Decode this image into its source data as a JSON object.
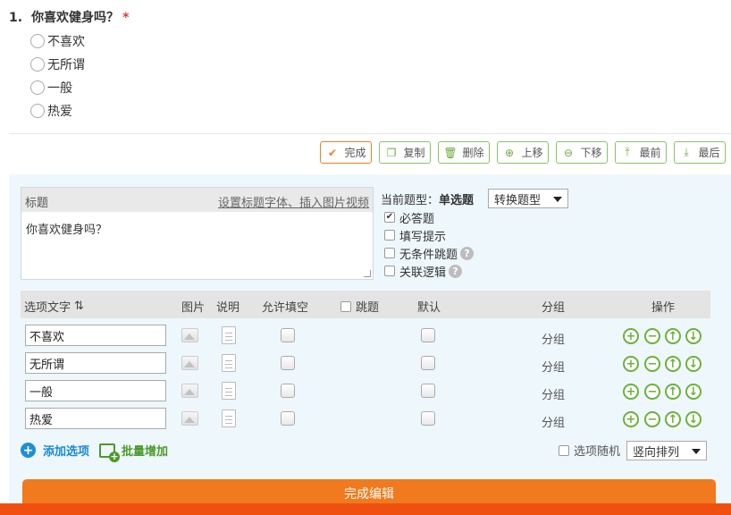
{
  "question": {
    "number": "1.",
    "title": "你喜欢健身吗？",
    "required_mark": "*",
    "options": [
      "不喜欢",
      "无所谓",
      "一般",
      "热爱"
    ]
  },
  "toolbar": {
    "done": "完成",
    "copy": "复制",
    "delete": "删除",
    "move_up": "上移",
    "move_down": "下移",
    "top": "最前",
    "bottom": "最后"
  },
  "editor": {
    "title_label": "标题",
    "title_link": "设置标题字体、插入图片视频",
    "title_value": "你喜欢健身吗？",
    "current_type_label": "当前题型：",
    "current_type": "单选题",
    "switch_type": "转换题型",
    "required_label": "必答题",
    "required_checked": true,
    "hint_label": "填写提示",
    "jump_label": "无条件跳题",
    "logic_label": "关联逻辑"
  },
  "table": {
    "headers": {
      "option_text": "选项文字",
      "image": "图片",
      "desc": "说明",
      "fill": "允许填空",
      "jump": "跳题",
      "default": "默认",
      "group": "分组",
      "ops": "操作"
    },
    "rows": [
      {
        "text": "不喜欢",
        "group": "分组"
      },
      {
        "text": "无所谓",
        "group": "分组"
      },
      {
        "text": "一般",
        "group": "分组"
      },
      {
        "text": "热爱",
        "group": "分组"
      }
    ]
  },
  "footer": {
    "add_option": "添加选项",
    "batch_add": "批量增加",
    "random_label": "选项随机",
    "arrange": "竖向排列",
    "finish": "完成编辑"
  },
  "colors": {
    "accent_orange": "#f07a1d",
    "green": "#6ab23a",
    "blue": "#1e8fd6",
    "required_red": "#e4393c"
  }
}
